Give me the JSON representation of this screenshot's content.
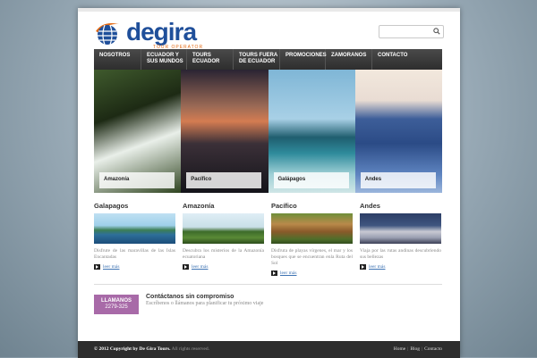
{
  "logo": {
    "text": "degira",
    "subtitle": "TOUR OPERATOR"
  },
  "search": {
    "placeholder": ""
  },
  "nav": [
    {
      "label": "Nosotros"
    },
    {
      "label": "Ecuador y sus mundos"
    },
    {
      "label": "Tours Ecuador"
    },
    {
      "label": "Tours fuera de Ecuador"
    },
    {
      "label": "Promociones"
    },
    {
      "label": "Zamoranos"
    },
    {
      "label": "Contacto"
    }
  ],
  "banner": [
    {
      "label": "Amazonía"
    },
    {
      "label": "Pacífico"
    },
    {
      "label": "Galápagos"
    },
    {
      "label": "Andes"
    }
  ],
  "columns": [
    {
      "title": "Galapagos",
      "text": "Disfrute de las maravillas de las Islas Encantadas",
      "more": "leer más"
    },
    {
      "title": "Amazonía",
      "text": "Descubra los misterios de la Amazonía ecuatoriana",
      "more": "leer más"
    },
    {
      "title": "Pacífico",
      "text": "Disfruta de playas vírgenes, el mar y los bosques que se encuentran enla Ruta del Sol",
      "more": "leer más"
    },
    {
      "title": "Andes",
      "text": "Viaja por las rutas andinas descubriendo sus bellezas",
      "more": "leer más"
    }
  ],
  "contact": {
    "call_label": "LLAMANOS",
    "call_number": "2279-325",
    "title": "Contáctanos sin compromiso",
    "subtitle": "Escríbenos o llámanos para planificar tu próximo viaje"
  },
  "footer": {
    "copyright": "© 2012 Copyright by De Gira Tours.",
    "rights": "All rights reserved.",
    "links": [
      {
        "label": "Home"
      },
      {
        "label": "Blog"
      },
      {
        "label": "Contacto"
      }
    ]
  },
  "colors": {
    "brand_blue": "#1f4f9a",
    "brand_orange": "#e36a14",
    "nav_bg": "#3a3a3a",
    "call_purple": "#a86aa8"
  }
}
